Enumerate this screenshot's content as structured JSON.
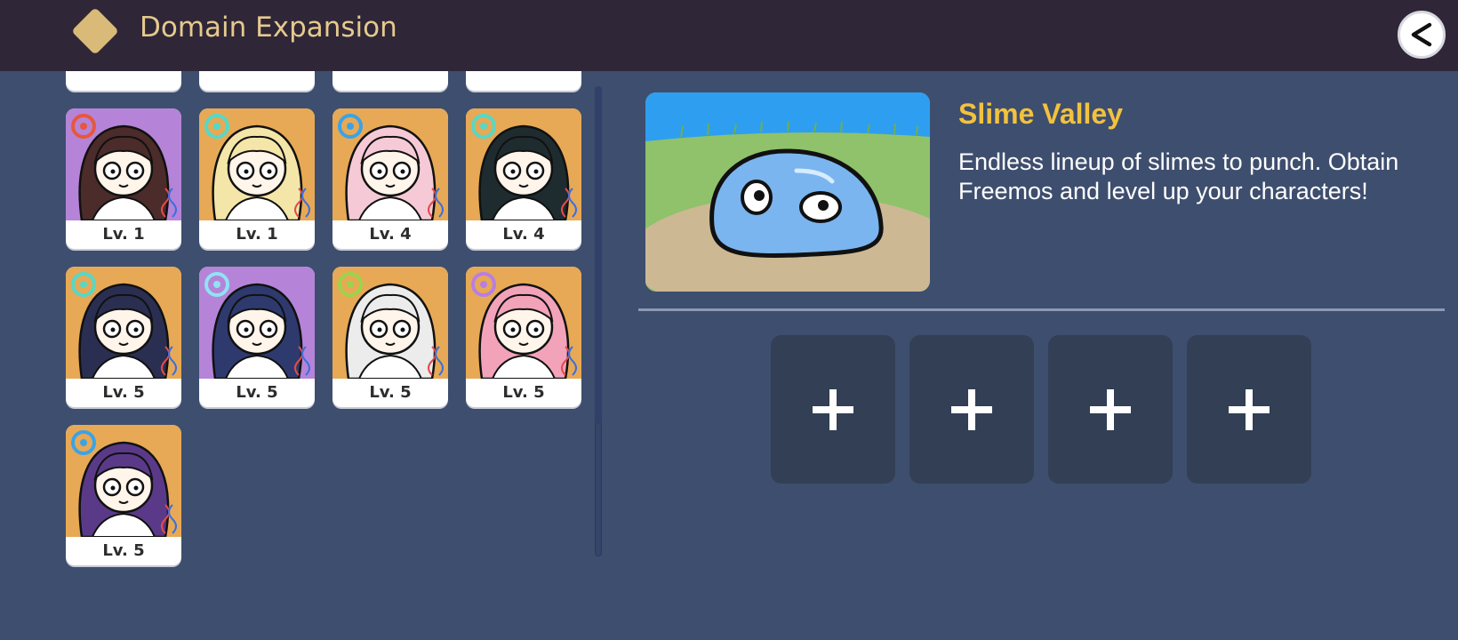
{
  "header": {
    "title": "Domain Expansion",
    "back_label": "<"
  },
  "roster": {
    "characters": [
      {
        "level": "Lv. 1",
        "bg": "#b584d8",
        "hair": "#4b2c2a",
        "element": "pyro-icon",
        "element_color": "#e8573a"
      },
      {
        "level": "Lv. 1",
        "bg": "#e7a955",
        "hair": "#f4e6a8",
        "element": "anemo-icon",
        "element_color": "#55d8c7"
      },
      {
        "level": "Lv. 4",
        "bg": "#e7a955",
        "hair": "#f5cad6",
        "element": "hydro-icon",
        "element_color": "#3aa3e8"
      },
      {
        "level": "Lv. 4",
        "bg": "#e7a955",
        "hair": "#1f2c2f",
        "element": "anemo-icon",
        "element_color": "#55d8c7"
      },
      {
        "level": "Lv. 5",
        "bg": "#e7a955",
        "hair": "#2a2f52",
        "element": "anemo-icon",
        "element_color": "#55d8c7"
      },
      {
        "level": "Lv. 5",
        "bg": "#b584d8",
        "hair": "#2e3a6e",
        "element": "cryo-icon",
        "element_color": "#8fe3f2"
      },
      {
        "level": "Lv. 5",
        "bg": "#e7a955",
        "hair": "#ececec",
        "element": "dendro-icon",
        "element_color": "#9bd44a"
      },
      {
        "level": "Lv. 5",
        "bg": "#e7a955",
        "hair": "#f2a3ba",
        "element": "electro-icon",
        "element_color": "#b77ee6"
      },
      {
        "level": "Lv. 5",
        "bg": "#e7a955",
        "hair": "#5a3a88",
        "element": "hydro-icon",
        "element_color": "#3aa3e8"
      }
    ]
  },
  "domain": {
    "name": "Slime Valley",
    "description": "Endless lineup of slimes to punch. Obtain Freemos and level up your characters!"
  },
  "party_slots": [
    {
      "icon": "plus-icon"
    },
    {
      "icon": "plus-icon"
    },
    {
      "icon": "plus-icon"
    },
    {
      "icon": "plus-icon"
    }
  ],
  "colors": {
    "background": "#3e4e6e",
    "topbar": "#2f2737",
    "title": "#e6c98e",
    "domain_name": "#f2c23e",
    "slot": "#323f55"
  }
}
